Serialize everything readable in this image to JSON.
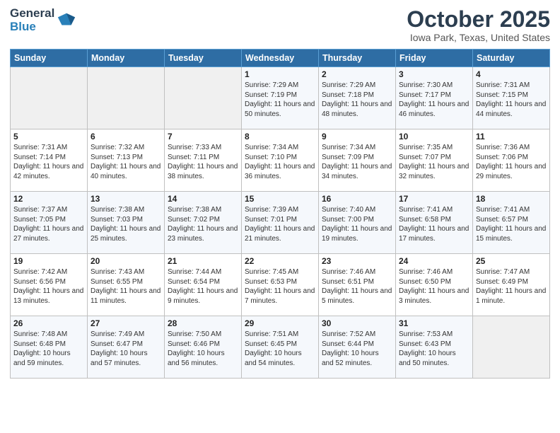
{
  "header": {
    "logo_general": "General",
    "logo_blue": "Blue",
    "month_title": "October 2025",
    "location": "Iowa Park, Texas, United States"
  },
  "days_of_week": [
    "Sunday",
    "Monday",
    "Tuesday",
    "Wednesday",
    "Thursday",
    "Friday",
    "Saturday"
  ],
  "weeks": [
    [
      {
        "day": "",
        "info": ""
      },
      {
        "day": "",
        "info": ""
      },
      {
        "day": "",
        "info": ""
      },
      {
        "day": "1",
        "info": "Sunrise: 7:29 AM\nSunset: 7:19 PM\nDaylight: 11 hours and 50 minutes."
      },
      {
        "day": "2",
        "info": "Sunrise: 7:29 AM\nSunset: 7:18 PM\nDaylight: 11 hours and 48 minutes."
      },
      {
        "day": "3",
        "info": "Sunrise: 7:30 AM\nSunset: 7:17 PM\nDaylight: 11 hours and 46 minutes."
      },
      {
        "day": "4",
        "info": "Sunrise: 7:31 AM\nSunset: 7:15 PM\nDaylight: 11 hours and 44 minutes."
      }
    ],
    [
      {
        "day": "5",
        "info": "Sunrise: 7:31 AM\nSunset: 7:14 PM\nDaylight: 11 hours and 42 minutes."
      },
      {
        "day": "6",
        "info": "Sunrise: 7:32 AM\nSunset: 7:13 PM\nDaylight: 11 hours and 40 minutes."
      },
      {
        "day": "7",
        "info": "Sunrise: 7:33 AM\nSunset: 7:11 PM\nDaylight: 11 hours and 38 minutes."
      },
      {
        "day": "8",
        "info": "Sunrise: 7:34 AM\nSunset: 7:10 PM\nDaylight: 11 hours and 36 minutes."
      },
      {
        "day": "9",
        "info": "Sunrise: 7:34 AM\nSunset: 7:09 PM\nDaylight: 11 hours and 34 minutes."
      },
      {
        "day": "10",
        "info": "Sunrise: 7:35 AM\nSunset: 7:07 PM\nDaylight: 11 hours and 32 minutes."
      },
      {
        "day": "11",
        "info": "Sunrise: 7:36 AM\nSunset: 7:06 PM\nDaylight: 11 hours and 29 minutes."
      }
    ],
    [
      {
        "day": "12",
        "info": "Sunrise: 7:37 AM\nSunset: 7:05 PM\nDaylight: 11 hours and 27 minutes."
      },
      {
        "day": "13",
        "info": "Sunrise: 7:38 AM\nSunset: 7:03 PM\nDaylight: 11 hours and 25 minutes."
      },
      {
        "day": "14",
        "info": "Sunrise: 7:38 AM\nSunset: 7:02 PM\nDaylight: 11 hours and 23 minutes."
      },
      {
        "day": "15",
        "info": "Sunrise: 7:39 AM\nSunset: 7:01 PM\nDaylight: 11 hours and 21 minutes."
      },
      {
        "day": "16",
        "info": "Sunrise: 7:40 AM\nSunset: 7:00 PM\nDaylight: 11 hours and 19 minutes."
      },
      {
        "day": "17",
        "info": "Sunrise: 7:41 AM\nSunset: 6:58 PM\nDaylight: 11 hours and 17 minutes."
      },
      {
        "day": "18",
        "info": "Sunrise: 7:41 AM\nSunset: 6:57 PM\nDaylight: 11 hours and 15 minutes."
      }
    ],
    [
      {
        "day": "19",
        "info": "Sunrise: 7:42 AM\nSunset: 6:56 PM\nDaylight: 11 hours and 13 minutes."
      },
      {
        "day": "20",
        "info": "Sunrise: 7:43 AM\nSunset: 6:55 PM\nDaylight: 11 hours and 11 minutes."
      },
      {
        "day": "21",
        "info": "Sunrise: 7:44 AM\nSunset: 6:54 PM\nDaylight: 11 hours and 9 minutes."
      },
      {
        "day": "22",
        "info": "Sunrise: 7:45 AM\nSunset: 6:53 PM\nDaylight: 11 hours and 7 minutes."
      },
      {
        "day": "23",
        "info": "Sunrise: 7:46 AM\nSunset: 6:51 PM\nDaylight: 11 hours and 5 minutes."
      },
      {
        "day": "24",
        "info": "Sunrise: 7:46 AM\nSunset: 6:50 PM\nDaylight: 11 hours and 3 minutes."
      },
      {
        "day": "25",
        "info": "Sunrise: 7:47 AM\nSunset: 6:49 PM\nDaylight: 11 hours and 1 minute."
      }
    ],
    [
      {
        "day": "26",
        "info": "Sunrise: 7:48 AM\nSunset: 6:48 PM\nDaylight: 10 hours and 59 minutes."
      },
      {
        "day": "27",
        "info": "Sunrise: 7:49 AM\nSunset: 6:47 PM\nDaylight: 10 hours and 57 minutes."
      },
      {
        "day": "28",
        "info": "Sunrise: 7:50 AM\nSunset: 6:46 PM\nDaylight: 10 hours and 56 minutes."
      },
      {
        "day": "29",
        "info": "Sunrise: 7:51 AM\nSunset: 6:45 PM\nDaylight: 10 hours and 54 minutes."
      },
      {
        "day": "30",
        "info": "Sunrise: 7:52 AM\nSunset: 6:44 PM\nDaylight: 10 hours and 52 minutes."
      },
      {
        "day": "31",
        "info": "Sunrise: 7:53 AM\nSunset: 6:43 PM\nDaylight: 10 hours and 50 minutes."
      },
      {
        "day": "",
        "info": ""
      }
    ]
  ]
}
